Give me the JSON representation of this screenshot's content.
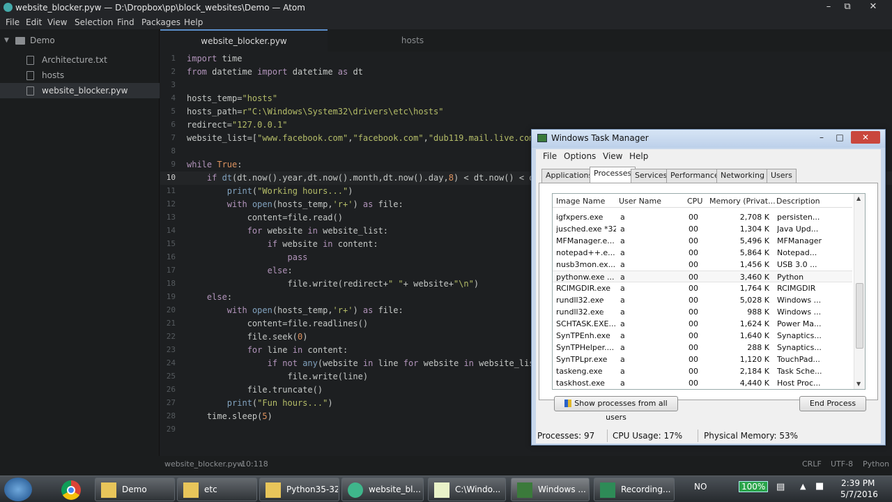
{
  "atom": {
    "window_title": "website_blocker.pyw — D:\\Dropbox\\pp\\block_websites\\Demo — Atom",
    "menu": [
      "File",
      "Edit",
      "View",
      "Selection",
      "Find",
      "Packages",
      "Help"
    ],
    "tree": {
      "root": "Demo",
      "files": [
        "Architecture.txt",
        "hosts",
        "website_blocker.pyw"
      ],
      "selected": "website_blocker.pyw"
    },
    "tabs": [
      {
        "label": "website_blocker.pyw",
        "active": true
      },
      {
        "label": "hosts",
        "active": false
      }
    ],
    "current_line": 10,
    "code_lines": [
      "import time",
      "from datetime import datetime as dt",
      "",
      "hosts_temp=\"hosts\"",
      "hosts_path=r\"C:\\Windows\\System32\\drivers\\etc\\hosts\"",
      "redirect=\"127.0.0.1\"",
      "website_list=[\"www.facebook.com\",\"facebook.com\",\"dub119.mail.live.com",
      "",
      "while True:",
      "    if dt(dt.now().year,dt.now().month,dt.now().day,8) < dt.now() < d",
      "        print(\"Working hours...\")",
      "        with open(hosts_temp,'r+') as file:",
      "            content=file.read()",
      "            for website in website_list:",
      "                if website in content:",
      "                    pass",
      "                else:",
      "                    file.write(redirect+\" \"+ website+\"\\n\")",
      "    else:",
      "        with open(hosts_temp,'r+') as file:",
      "            content=file.readlines()",
      "            file.seek(0)",
      "            for line in content:",
      "                if not any(website in line for website in website_lis",
      "                    file.write(line)",
      "            file.truncate()",
      "        print(\"Fun hours...\")",
      "    time.sleep(5)",
      ""
    ],
    "status": {
      "file": "website_blocker.pyw",
      "cursor": "10:118",
      "line_ending": "CRLF",
      "encoding": "UTF-8",
      "grammar": "Python"
    }
  },
  "task_manager": {
    "title": "Windows Task Manager",
    "menu": [
      "File",
      "Options",
      "View",
      "Help"
    ],
    "tabs": [
      "Applications",
      "Processes",
      "Services",
      "Performance",
      "Networking",
      "Users"
    ],
    "active_tab": "Processes",
    "columns": [
      "Image Name",
      "User Name",
      "CPU",
      "Memory (Privat...",
      "Description"
    ],
    "rows": [
      {
        "name": "igfxpers.exe",
        "user": "a",
        "cpu": "00",
        "mem": "2,708 K",
        "desc": "persisten..."
      },
      {
        "name": "jusched.exe *32",
        "user": "a",
        "cpu": "00",
        "mem": "1,304 K",
        "desc": "Java Upd..."
      },
      {
        "name": "MFManager.e...",
        "user": "a",
        "cpu": "00",
        "mem": "5,496 K",
        "desc": "MFManager"
      },
      {
        "name": "notepad++.e...",
        "user": "a",
        "cpu": "00",
        "mem": "5,864 K",
        "desc": "Notepad..."
      },
      {
        "name": "nusb3mon.ex...",
        "user": "a",
        "cpu": "00",
        "mem": "1,456 K",
        "desc": "USB 3.0 ..."
      },
      {
        "name": "pythonw.exe ...",
        "user": "a",
        "cpu": "00",
        "mem": "3,460 K",
        "desc": "Python"
      },
      {
        "name": "RCIMGDIR.exe",
        "user": "a",
        "cpu": "00",
        "mem": "1,764 K",
        "desc": "RCIMGDIR"
      },
      {
        "name": "rundll32.exe",
        "user": "a",
        "cpu": "00",
        "mem": "5,028 K",
        "desc": "Windows ..."
      },
      {
        "name": "rundll32.exe",
        "user": "a",
        "cpu": "00",
        "mem": "988 K",
        "desc": "Windows ..."
      },
      {
        "name": "SCHTASK.EXE...",
        "user": "a",
        "cpu": "00",
        "mem": "1,624 K",
        "desc": "Power Ma..."
      },
      {
        "name": "SynTPEnh.exe",
        "user": "a",
        "cpu": "00",
        "mem": "1,640 K",
        "desc": "Synaptics..."
      },
      {
        "name": "SynTPHelper....",
        "user": "a",
        "cpu": "00",
        "mem": "288 K",
        "desc": "Synaptics..."
      },
      {
        "name": "SynTPLpr.exe",
        "user": "a",
        "cpu": "00",
        "mem": "1,120 K",
        "desc": "TouchPad..."
      },
      {
        "name": "taskeng.exe",
        "user": "a",
        "cpu": "00",
        "mem": "2,184 K",
        "desc": "Task Sche..."
      },
      {
        "name": "taskhost.exe",
        "user": "a",
        "cpu": "00",
        "mem": "4,440 K",
        "desc": "Host Proc..."
      }
    ],
    "highlighted_row": 5,
    "show_all_label": "Show processes from all users",
    "end_process_label": "End Process",
    "status": {
      "processes": "Processes: 97",
      "cpu": "CPU Usage: 17%",
      "memory": "Physical Memory: 53%"
    }
  },
  "taskbar": {
    "buttons": [
      "Demo",
      "etc",
      "Python35-32",
      "website_bl...",
      "C:\\Windo...",
      "Windows ...",
      "Recording..."
    ],
    "lang": "NO",
    "battery": "100%",
    "time": "2:39 PM",
    "date": "5/7/2016"
  },
  "colors": {
    "atom_bg": "#1d1f21",
    "tab_accent": "#5b8ec9",
    "tm_frame": "#c8d8ec",
    "taskbar": "#2e3338"
  },
  "icons": [
    "atom-icon",
    "folder-icon",
    "file-icon",
    "chevron-down-icon",
    "windows-start-icon",
    "chrome-icon",
    "mouse-cursor-icon"
  ]
}
